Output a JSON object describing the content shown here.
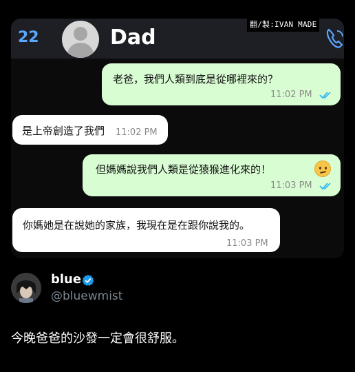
{
  "header": {
    "back_count": "22",
    "contact_name": "Dad",
    "watermark": "翻/製:IVAN MADE"
  },
  "messages": [
    {
      "direction": "sent",
      "text": "老爸，我們人類到底是從哪裡來的？",
      "time": "11:02 PM",
      "read": true
    },
    {
      "direction": "received",
      "text": "是上帝創造了我們",
      "time": "11:02 PM"
    },
    {
      "direction": "sent",
      "text": "但媽媽說我們人類是從猿猴進化來的！",
      "time": "11:03 PM",
      "read": true,
      "emoji": "confused-face"
    },
    {
      "direction": "received",
      "text": "你媽她是在說她的家族，我現在是在跟你說我的。",
      "time": "11:03 PM"
    }
  ],
  "tweet": {
    "name": "blue",
    "handle": "@bluewmist",
    "text": "今晚爸爸的沙發一定會很舒服。"
  },
  "colors": {
    "sent_bubble": "#d9fdd3",
    "received_bubble": "#ffffff",
    "read_ticks": "#34b7f1",
    "back_blue": "#5aa7ff",
    "verified": "#1d9bf0"
  }
}
